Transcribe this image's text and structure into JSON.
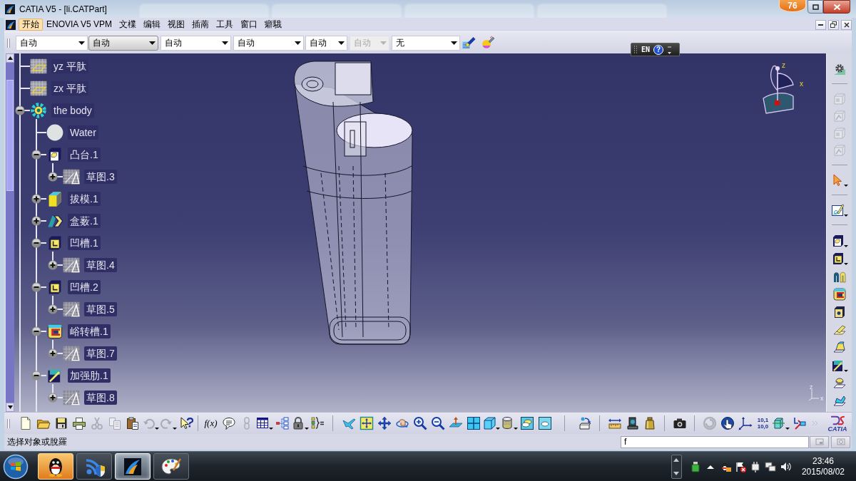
{
  "window": {
    "title": "CATIA V5 - [li.CATPart]",
    "badge": "76"
  },
  "menu": [
    {
      "label": "开始",
      "selected": true
    },
    {
      "label": "ENOVIA V5 VPM",
      "selected": false
    },
    {
      "label": "文檏",
      "selected": false
    },
    {
      "label": "编辑",
      "selected": false
    },
    {
      "label": "视图",
      "selected": false
    },
    {
      "label": "插萳",
      "selected": false
    },
    {
      "label": "工具",
      "selected": false
    },
    {
      "label": "窗口",
      "selected": false
    },
    {
      "label": "癖騀",
      "selected": false
    }
  ],
  "style_toolbar": {
    "dropdowns": [
      {
        "value": "自动",
        "highlighted": false,
        "disabled": false
      },
      {
        "value": "自动",
        "highlighted": true,
        "disabled": false
      },
      {
        "value": "自动",
        "highlighted": false,
        "disabled": false
      },
      {
        "value": "自动",
        "highlighted": false,
        "disabled": false
      },
      {
        "value": "自动",
        "highlighted": false,
        "disabled": false
      },
      {
        "value": "自动",
        "highlighted": false,
        "disabled": true
      },
      {
        "value": "无",
        "highlighted": false,
        "disabled": false
      }
    ]
  },
  "language_bar": {
    "language": "EN",
    "help": "?"
  },
  "tree": [
    {
      "label": "yz 平肽",
      "kind": "plane"
    },
    {
      "label": "zx 平肽",
      "kind": "plane"
    },
    {
      "label": "the body",
      "kind": "body",
      "expanded": true,
      "children": [
        {
          "label": "Water",
          "kind": "material"
        },
        {
          "label": "凸台.1",
          "kind": "pad",
          "expanded": true,
          "children": [
            {
              "label": "草图.3",
              "kind": "sketch",
              "expanded": false
            }
          ]
        },
        {
          "label": "拔模.1",
          "kind": "draft",
          "expanded": false
        },
        {
          "label": "盒薮.1",
          "kind": "shell",
          "expanded": false
        },
        {
          "label": "凹槽.1",
          "kind": "pocket",
          "expanded": true,
          "children": [
            {
              "label": "草图.4",
              "kind": "sketch",
              "expanded": false
            }
          ]
        },
        {
          "label": "凹槽.2",
          "kind": "pocket",
          "expanded": true,
          "children": [
            {
              "label": "草图.5",
              "kind": "sketch",
              "expanded": false
            }
          ]
        },
        {
          "label": "峪转槽.1",
          "kind": "slot",
          "expanded": true,
          "children": [
            {
              "label": "草图.7",
              "kind": "sketch",
              "expanded": false
            }
          ]
        },
        {
          "label": "加强肋.1",
          "kind": "rib",
          "expanded": true,
          "children": [
            {
              "label": "草图.8",
              "kind": "sketch",
              "expanded": false
            }
          ]
        }
      ]
    }
  ],
  "compass": {
    "labels": [
      "z",
      "x"
    ]
  },
  "axis_triad": {
    "labels": [
      "z",
      "x"
    ]
  },
  "bottom_toolbar": {
    "formula": "f(x)",
    "number_format": [
      "10,1",
      "10,0"
    ],
    "brand": "CATIA"
  },
  "status_bar": {
    "message": "选择对象或脫羅",
    "command": "f"
  },
  "taskbar": {
    "buttons": [
      {
        "selected": false,
        "flashing": true
      },
      {
        "selected": false,
        "flashing": false
      },
      {
        "selected": true,
        "flashing": false
      },
      {
        "selected": false,
        "flashing": false
      }
    ],
    "time": "23:46",
    "date": "2015/08/02"
  }
}
